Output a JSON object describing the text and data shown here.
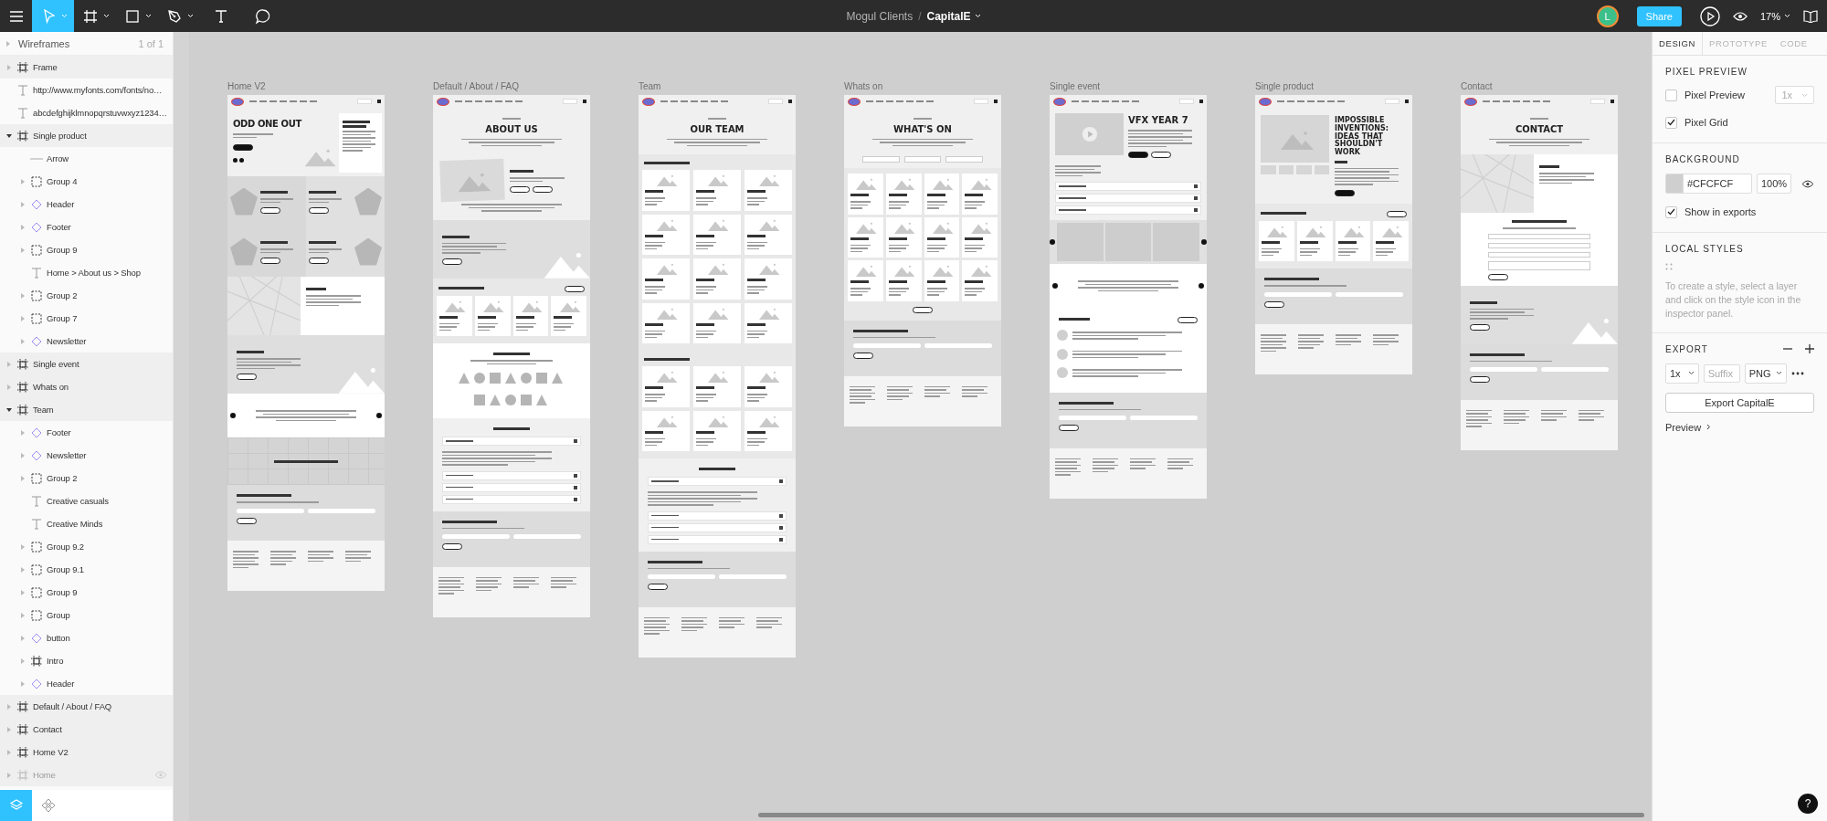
{
  "toolbar": {
    "tools": [
      {
        "kind": "move",
        "selected": true
      },
      {
        "kind": "frame",
        "selected": false
      },
      {
        "kind": "shape",
        "selected": false
      },
      {
        "kind": "pen",
        "selected": false
      },
      {
        "kind": "text",
        "selected": false
      },
      {
        "kind": "comment",
        "selected": false
      }
    ],
    "project": "Mogul Clients",
    "separator": "/",
    "file": "CapitalE",
    "avatar": "L",
    "share": "Share",
    "zoom": "17%"
  },
  "layers": {
    "page": "Wireframes",
    "page_count": "1 of 1",
    "items": [
      {
        "name": "Frame",
        "kind": "frame",
        "expanded": false,
        "hidden": false
      },
      {
        "name": "http://www.myfonts.com/fonts/no…",
        "kind": "text",
        "hidden": false
      },
      {
        "name": "abcdefghijklmnopqrstuvwxyz1234…",
        "kind": "text",
        "hidden": false
      },
      {
        "name": "Single product",
        "kind": "frame",
        "expanded": true,
        "hidden": false,
        "children": [
          {
            "name": "Arrow",
            "kind": "line"
          },
          {
            "name": "Group 4",
            "kind": "group",
            "expanded": false
          },
          {
            "name": "Header",
            "kind": "component",
            "expanded": false
          },
          {
            "name": "Footer",
            "kind": "component",
            "expanded": false
          },
          {
            "name": "Group 9",
            "kind": "group",
            "expanded": false
          },
          {
            "name": "Home > About us > Shop",
            "kind": "text"
          },
          {
            "name": "Group 2",
            "kind": "group",
            "expanded": false
          },
          {
            "name": "Group 7",
            "kind": "group",
            "expanded": false
          },
          {
            "name": "Newsletter",
            "kind": "component",
            "expanded": false
          }
        ]
      },
      {
        "name": "Single event",
        "kind": "frame",
        "expanded": false,
        "hidden": false
      },
      {
        "name": "Whats on",
        "kind": "frame",
        "expanded": false,
        "hidden": false
      },
      {
        "name": "Team",
        "kind": "frame",
        "expanded": true,
        "hidden": false,
        "children": [
          {
            "name": "Footer",
            "kind": "component",
            "expanded": false
          },
          {
            "name": "Newsletter",
            "kind": "component",
            "expanded": false
          },
          {
            "name": "Group 2",
            "kind": "group",
            "expanded": false
          },
          {
            "name": "Creative casuals",
            "kind": "text"
          },
          {
            "name": "Creative Minds",
            "kind": "text"
          },
          {
            "name": "Group 9.2",
            "kind": "group",
            "expanded": false
          },
          {
            "name": "Group 9.1",
            "kind": "group",
            "expanded": false
          },
          {
            "name": "Group 9",
            "kind": "group",
            "expanded": false
          },
          {
            "name": "Group",
            "kind": "group",
            "expanded": false
          },
          {
            "name": "button",
            "kind": "component",
            "expanded": false
          },
          {
            "name": "Intro",
            "kind": "frame",
            "expanded": false
          },
          {
            "name": "Header",
            "kind": "component",
            "expanded": false
          }
        ]
      },
      {
        "name": "Default / About / FAQ",
        "kind": "frame",
        "expanded": false,
        "hidden": false
      },
      {
        "name": "Contact",
        "kind": "frame",
        "expanded": false,
        "hidden": false
      },
      {
        "name": "Home V2",
        "kind": "frame",
        "expanded": false,
        "hidden": false
      },
      {
        "name": "Home",
        "kind": "frame",
        "expanded": false,
        "hidden": true
      }
    ],
    "tabs": [
      {
        "kind": "layers",
        "selected": true
      },
      {
        "kind": "assets",
        "selected": false
      }
    ]
  },
  "canvas": {
    "frames": [
      {
        "label": "Home V2",
        "sections": [
          {
            "kind": "nav"
          },
          {
            "kind": "hero",
            "title": "ODD ONE OUT"
          },
          {
            "kind": "events"
          },
          {
            "kind": "map"
          },
          {
            "kind": "band"
          },
          {
            "kind": "quote"
          },
          {
            "kind": "strip"
          },
          {
            "kind": "newsletter"
          },
          {
            "kind": "footer"
          }
        ]
      },
      {
        "label": "Default / About / FAQ",
        "sections": [
          {
            "kind": "nav"
          },
          {
            "kind": "center",
            "title": "ABOUT US"
          },
          {
            "kind": "feature"
          },
          {
            "kind": "band"
          },
          {
            "kind": "products"
          },
          {
            "kind": "partners"
          },
          {
            "kind": "faq"
          },
          {
            "kind": "newsletter"
          },
          {
            "kind": "footer"
          }
        ]
      },
      {
        "label": "Team",
        "sections": [
          {
            "kind": "nav"
          },
          {
            "kind": "center",
            "title": "OUR TEAM"
          },
          {
            "kind": "team"
          },
          {
            "kind": "crew"
          },
          {
            "kind": "faq"
          },
          {
            "kind": "newsletter"
          },
          {
            "kind": "footer"
          }
        ]
      },
      {
        "label": "Whats on",
        "sections": [
          {
            "kind": "nav"
          },
          {
            "kind": "center",
            "title": "WHAT'S ON"
          },
          {
            "kind": "filters"
          },
          {
            "kind": "listings"
          },
          {
            "kind": "newsletter"
          },
          {
            "kind": "footer"
          }
        ]
      },
      {
        "label": "Single event",
        "sections": [
          {
            "kind": "nav"
          },
          {
            "kind": "eventhero",
            "title": "VFX YEAR 7"
          },
          {
            "kind": "gallery"
          },
          {
            "kind": "quote"
          },
          {
            "kind": "comments"
          },
          {
            "kind": "newsletter"
          },
          {
            "kind": "footer"
          }
        ]
      },
      {
        "label": "Single product",
        "sections": [
          {
            "kind": "nav"
          },
          {
            "kind": "product",
            "title": "IMPOSSIBLE INVENTIONS: IDEAS THAT SHOULDN'T WORK"
          },
          {
            "kind": "products"
          },
          {
            "kind": "newsletter"
          },
          {
            "kind": "footer"
          }
        ]
      },
      {
        "label": "Contact",
        "sections": [
          {
            "kind": "nav"
          },
          {
            "kind": "center",
            "title": "CONTACT"
          },
          {
            "kind": "map"
          },
          {
            "kind": "form"
          },
          {
            "kind": "band"
          },
          {
            "kind": "newsletter"
          },
          {
            "kind": "footer"
          }
        ]
      }
    ]
  },
  "inspector": {
    "tabs": [
      {
        "label": "DESIGN",
        "selected": true
      },
      {
        "label": "PROTOTYPE",
        "selected": false
      },
      {
        "label": "CODE",
        "selected": false
      }
    ],
    "pixel_preview": {
      "title": "PIXEL PREVIEW",
      "options": [
        {
          "label": "Pixel Preview",
          "checked": false
        },
        {
          "label": "Pixel Grid",
          "checked": true
        }
      ],
      "scale": "1x"
    },
    "background": {
      "title": "BACKGROUND",
      "hex": "#CFCFCF",
      "opacity": "100%",
      "option": {
        "label": "Show in exports",
        "checked": true
      }
    },
    "local_styles": {
      "title": "LOCAL STYLES",
      "hint": "To create a style, select a layer and click on the style icon in the inspector panel."
    },
    "export": {
      "title": "EXPORT",
      "scale": "1x",
      "placeholder": "Suffix",
      "format": "PNG",
      "button": "Export CapitalE",
      "preview": "Preview"
    },
    "help": "?"
  }
}
